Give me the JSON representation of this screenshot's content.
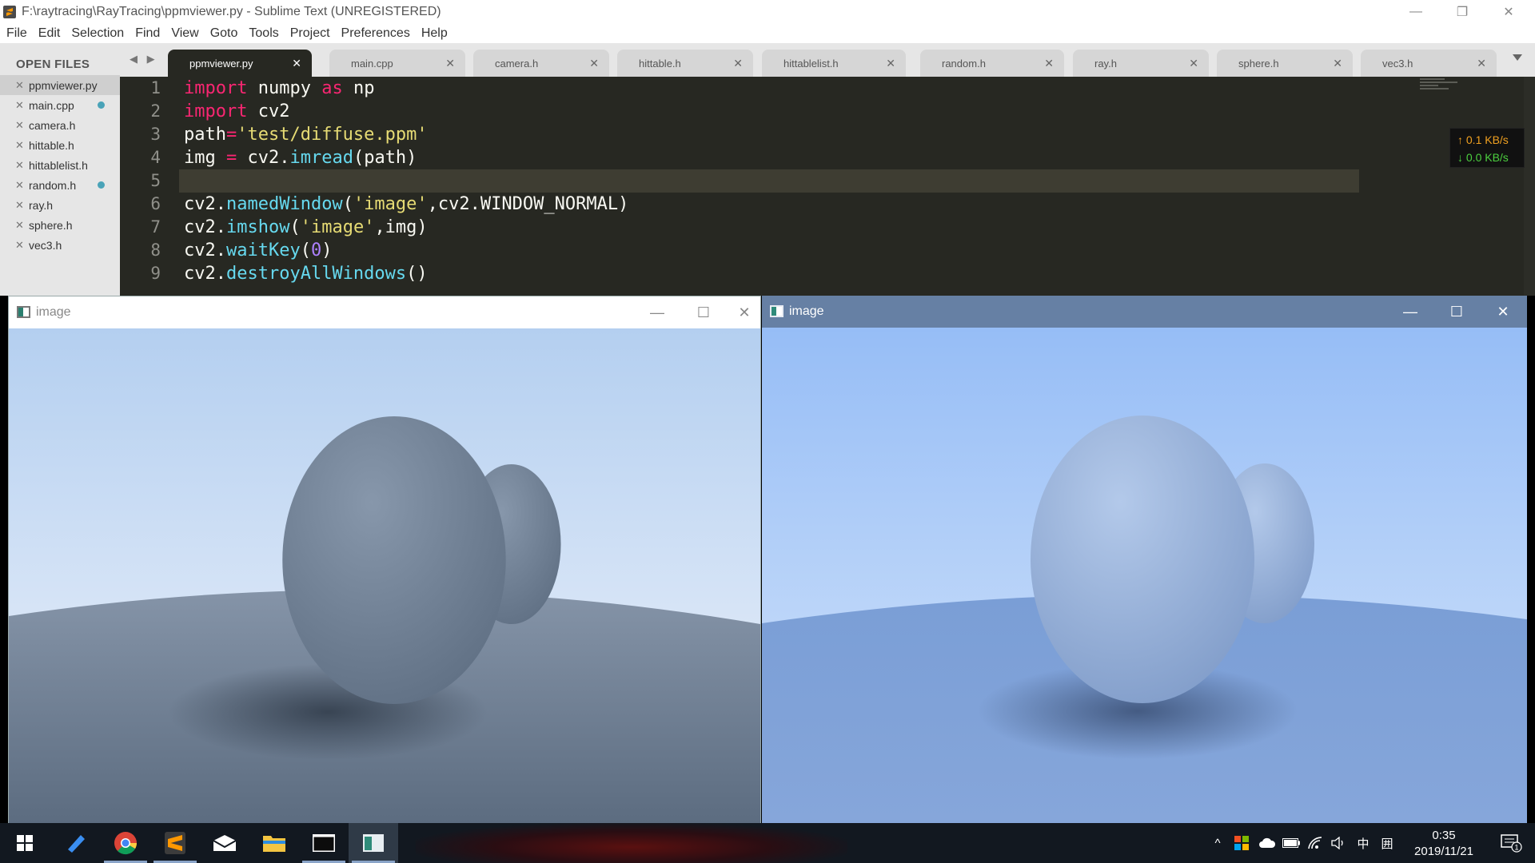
{
  "window": {
    "title": "F:\\raytracing\\RayTracing\\ppmviewer.py - Sublime Text (UNREGISTERED)",
    "minimize": "—",
    "restore": "❐",
    "close": "✕"
  },
  "menu": [
    "File",
    "Edit",
    "Selection",
    "Find",
    "View",
    "Goto",
    "Tools",
    "Project",
    "Preferences",
    "Help"
  ],
  "sidebar": {
    "heading": "OPEN FILES",
    "close_glyph": "✕",
    "files": [
      {
        "name": "ppmviewer.py",
        "active": true,
        "modified": false
      },
      {
        "name": "main.cpp",
        "active": false,
        "modified": true
      },
      {
        "name": "camera.h",
        "active": false,
        "modified": false
      },
      {
        "name": "hittable.h",
        "active": false,
        "modified": false
      },
      {
        "name": "hittablelist.h",
        "active": false,
        "modified": false
      },
      {
        "name": "random.h",
        "active": false,
        "modified": true
      },
      {
        "name": "ray.h",
        "active": false,
        "modified": false
      },
      {
        "name": "sphere.h",
        "active": false,
        "modified": false
      },
      {
        "name": "vec3.h",
        "active": false,
        "modified": false
      }
    ]
  },
  "tabs": {
    "nav": "◀ ▶",
    "close_glyph": "✕",
    "items": [
      "ppmviewer.py",
      "main.cpp",
      "camera.h",
      "hittable.h",
      "hittablelist.h",
      "random.h",
      "ray.h",
      "sphere.h",
      "vec3.h"
    ]
  },
  "editor": {
    "line_numbers": [
      "1",
      "2",
      "3",
      "4",
      "5",
      "6",
      "7",
      "8",
      "9"
    ],
    "current_line": 5,
    "code": {
      "l1": {
        "kw1": "import",
        "t1": " numpy ",
        "kw2": "as",
        "t2": " np"
      },
      "l2": {
        "kw1": "import",
        "t1": " cv2"
      },
      "l3": {
        "t1": "path",
        "op": "=",
        "s1": "'test/diffuse.ppm'"
      },
      "l4": {
        "t1": "img ",
        "op": "=",
        "t2": " cv2.",
        "f1": "imread",
        "t3": "(path)"
      },
      "l6": {
        "t1": "cv2.",
        "f1": "namedWindow",
        "t2": "(",
        "s1": "'image'",
        "t3": ",cv2.WINDOW_NORMAL)"
      },
      "l7": {
        "t1": "cv2.",
        "f1": "imshow",
        "t2": "(",
        "s1": "'image'",
        "t3": ",img)"
      },
      "l8": {
        "t1": "cv2.",
        "f1": "waitKey",
        "t2": "(",
        "n1": "0",
        "t3": ")"
      },
      "l9": {
        "t1": "cv2.",
        "f1": "destroyAllWindows",
        "t2": "()"
      }
    }
  },
  "network": {
    "upload": "↑ 0.1 KB/s",
    "download": "↓ 0.0 KB/s"
  },
  "image_windows": [
    {
      "title": "image",
      "minimize": "—",
      "maximize": "☐",
      "close": "✕"
    },
    {
      "title": "image",
      "minimize": "—",
      "maximize": "☐",
      "close": "✕"
    }
  ],
  "taskbar": {
    "tray": {
      "chevron": "^",
      "ime": "中",
      "ime_grid": "囲"
    },
    "time": "0:35",
    "date": "2019/11/21",
    "notifications": "1"
  },
  "colors": {
    "editor_bg": "#272822",
    "keyword": "#f92672",
    "string": "#e6db74",
    "function": "#66d9ef",
    "number": "#ae81ff",
    "taskbar": "#121820"
  }
}
